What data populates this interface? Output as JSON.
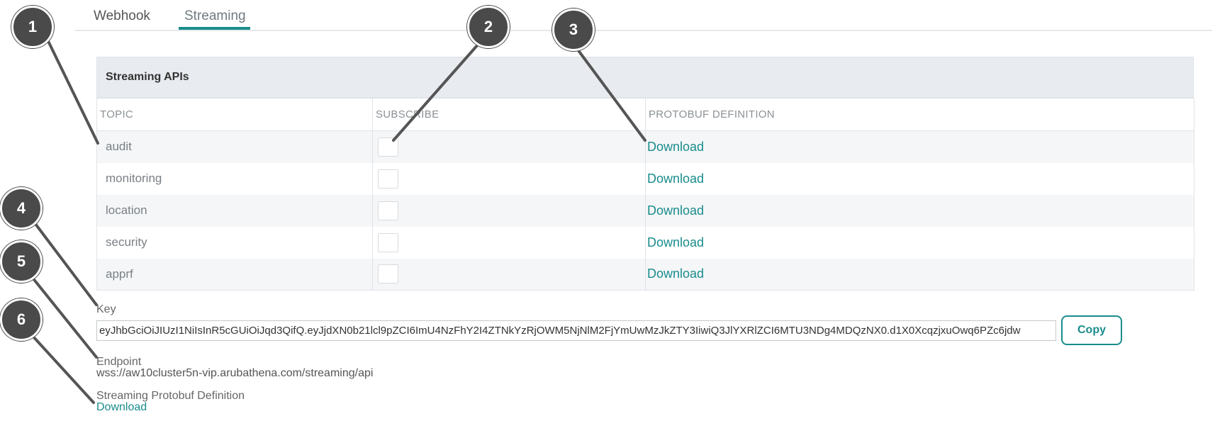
{
  "tabs": [
    {
      "label": "Webhook"
    },
    {
      "label": "Streaming"
    }
  ],
  "panel": {
    "title": "Streaming APIs",
    "columns": [
      "TOPIC",
      "SUBSCRIBE",
      "PROTOBUF DEFINITION"
    ],
    "rows": [
      {
        "topic": "audit",
        "subscribed": false,
        "link": "Download"
      },
      {
        "topic": "monitoring",
        "subscribed": false,
        "link": "Download"
      },
      {
        "topic": "location",
        "subscribed": false,
        "link": "Download"
      },
      {
        "topic": "security",
        "subscribed": false,
        "link": "Download"
      },
      {
        "topic": "apprf",
        "subscribed": false,
        "link": "Download"
      }
    ]
  },
  "key": {
    "label": "Key",
    "value": "eyJhbGciOiJIUzI1NiIsInR5cGUiOiJqd3QifQ.eyJjdXN0b21lcl9pZCI6ImU4NzFhY2I4ZTNkYzRjOWM5NjNlM2FjYmUwMzJkZTY3IiwiQ3JlYXRlZCI6MTU3NDg4MDQzNX0.d1X0XcqzjxuOwq6PZc6jdw",
    "copy_label": "Copy"
  },
  "endpoint": {
    "label": "Endpoint",
    "value": "wss://aw10cluster5n-vip.arubathena.com/streaming/api"
  },
  "protobuf": {
    "label": "Streaming Protobuf Definition",
    "link": "Download"
  },
  "callouts": [
    "1",
    "2",
    "3",
    "4",
    "5",
    "6"
  ],
  "colors": {
    "accent": "#1a8c8c",
    "callout_bg": "#4a4a4a",
    "header_bg": "#e8ebef"
  }
}
